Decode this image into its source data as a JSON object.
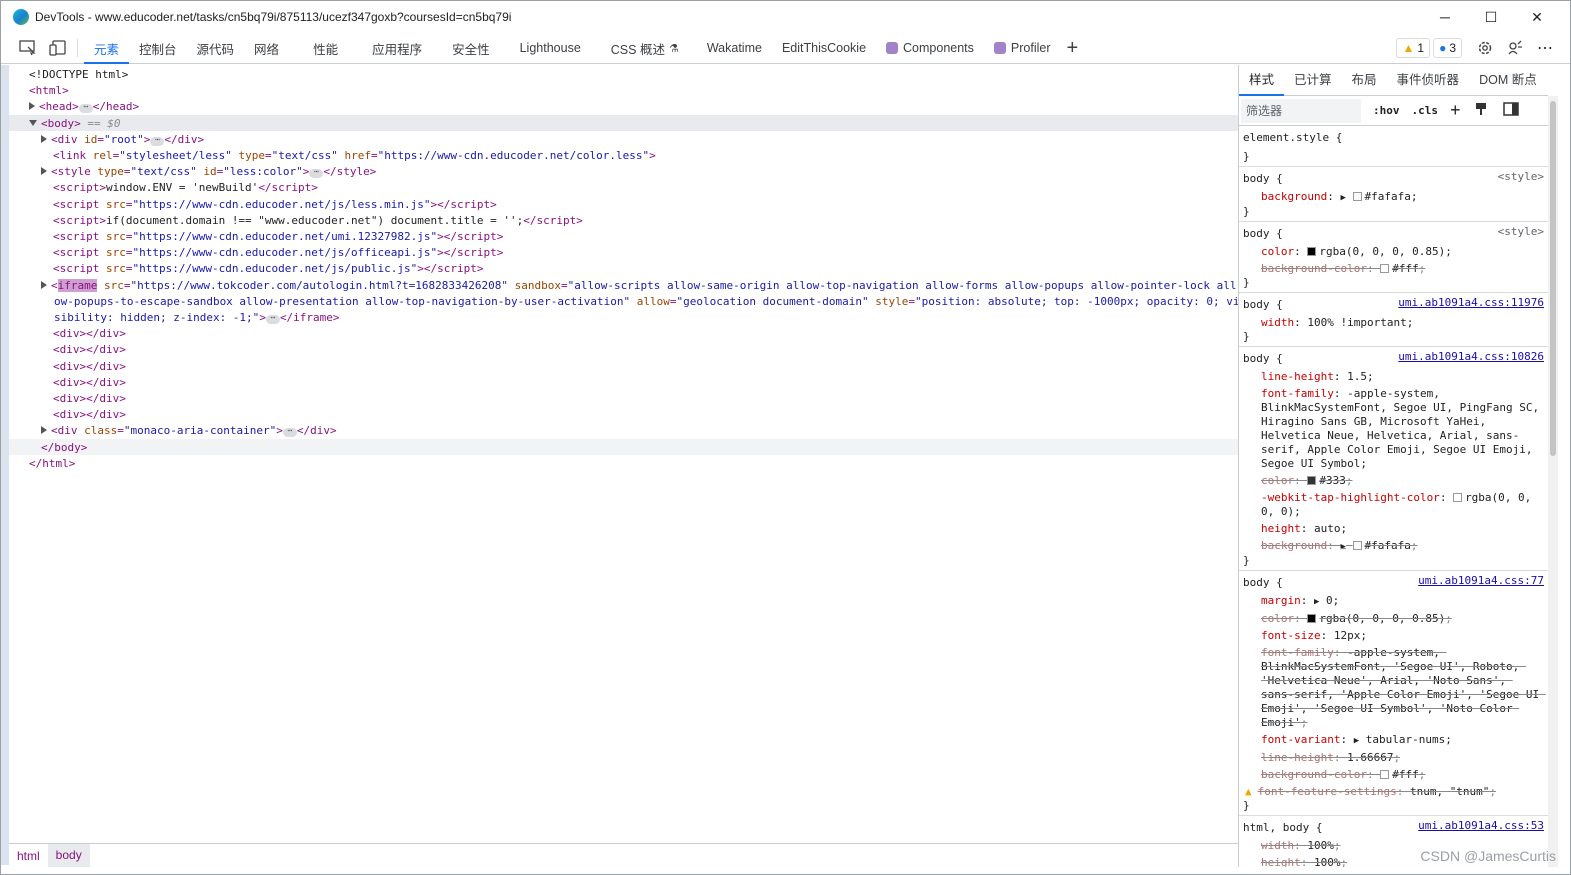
{
  "window": {
    "title": "DevTools - www.educoder.net/tasks/cn5bq79i/875113/ucezf347goxb?coursesId=cn5bq79i",
    "controls": [
      "─",
      "☐",
      "✕"
    ]
  },
  "toolbar": {
    "tabs": [
      "元素",
      "控制台",
      "源代码",
      "网络",
      "性能",
      "应用程序",
      "安全性",
      "Lighthouse",
      "CSS 概述",
      "Wakatime",
      "EditThisCookie",
      "Components",
      "Profiler"
    ],
    "active_tab": "元素",
    "warnings_count": "1",
    "messages_count": "3",
    "add_tab": "+"
  },
  "elements": {
    "dom_lines": [
      {
        "kind": "text",
        "text": "<!DOCTYPE html>",
        "indent": 0
      },
      {
        "kind": "open",
        "tag": "html",
        "indent": 0
      },
      {
        "kind": "collapsed",
        "tag": "head",
        "indent": 1
      },
      {
        "kind": "body",
        "tag": "body",
        "marker": "== $0",
        "indent": 1
      },
      {
        "kind": "collapsed_attr",
        "tag": "div",
        "attrs": [
          [
            "id",
            "root"
          ]
        ],
        "indent": 2
      },
      {
        "kind": "void",
        "tag": "link",
        "attrs": [
          [
            "rel",
            "stylesheet/less"
          ],
          [
            "type",
            "text/css"
          ],
          [
            "href",
            "https://www-cdn.educoder.net/color.less"
          ]
        ],
        "indent": 2
      },
      {
        "kind": "collapsed_attr",
        "tag": "style",
        "attrs": [
          [
            "type",
            "text/css"
          ],
          [
            "id",
            "less:color"
          ]
        ],
        "indent": 2
      },
      {
        "kind": "script_text",
        "tag": "script",
        "text": "window.ENV = 'newBuild'",
        "indent": 2
      },
      {
        "kind": "script_src",
        "tag": "script",
        "attrs": [
          [
            "src",
            "https://www-cdn.educoder.net/js/less.min.js"
          ]
        ],
        "indent": 2
      },
      {
        "kind": "script_text",
        "tag": "script",
        "text": "if(document.domain !== \"www.educoder.net\") document.title = '';",
        "indent": 2
      },
      {
        "kind": "script_src",
        "tag": "script",
        "attrs": [
          [
            "src",
            "https://www-cdn.educoder.net/umi.12327982.js"
          ]
        ],
        "indent": 2
      },
      {
        "kind": "script_src",
        "tag": "script",
        "attrs": [
          [
            "src",
            "https://www-cdn.educoder.net/js/officeapi.js"
          ]
        ],
        "indent": 2
      },
      {
        "kind": "script_src",
        "tag": "script",
        "attrs": [
          [
            "src",
            "https://www-cdn.educoder.net/js/public.js"
          ]
        ],
        "indent": 2
      }
    ],
    "iframe": {
      "line1_src": "https://www.tokcoder.com/autologin.html?t=1682833426208",
      "line1_sandbox_start": "allow-scripts allow-same-origin allow-top-navigation allow-forms allow-popups allow-pointer-lock all",
      "line2_sandbox_end": "ow-popups-to-escape-sandbox allow-presentation allow-top-navigation-by-user-activation",
      "allow": "geolocation document-domain",
      "style_start": "position: absolute; top: -1000px; opacity: 0; vi",
      "line3": "sibility: hidden; z-index: -1;"
    },
    "empty_divs": 6,
    "monaco": "monaco-aria-container"
  },
  "breadcrumbs": [
    "html",
    "body"
  ],
  "styles_pane": {
    "tabs": [
      "样式",
      "已计算",
      "布局",
      "事件侦听器",
      "DOM 断点"
    ],
    "filter_placeholder": "筛选器",
    "hov": ":hov",
    "cls": ".cls",
    "rules": [
      {
        "selector": "element.style {",
        "source": "",
        "props": []
      },
      {
        "selector": "body {",
        "source": "<style>",
        "props": [
          {
            "n": "background",
            "v": "#fafafa",
            "sw": "#fafafa",
            "arrow": true
          }
        ]
      },
      {
        "selector": "body {",
        "source": "<style>",
        "props": [
          {
            "n": "color",
            "v": "rgba(0, 0, 0, 0.85)",
            "sw": "#000"
          },
          {
            "n": "background-color",
            "v": "#fff",
            "sw": "#fff",
            "strike": true
          }
        ]
      },
      {
        "selector": "body {",
        "source": "umi.ab1091a4.css:11976",
        "props": [
          {
            "n": "width",
            "v": "100% !important"
          }
        ]
      },
      {
        "selector": "body {",
        "source": "umi.ab1091a4.css:10826",
        "props": [
          {
            "n": "line-height",
            "v": "1.5"
          },
          {
            "n": "font-family",
            "v": "-apple-system, BlinkMacSystemFont, Segoe UI, PingFang SC, Hiragino Sans GB, Microsoft YaHei, Helvetica Neue, Helvetica, Arial, sans-serif, Apple Color Emoji, Segoe UI Emoji, Segoe UI Symbol"
          },
          {
            "n": "color",
            "v": "#333",
            "sw": "#333",
            "strike": true
          },
          {
            "n": "-webkit-tap-highlight-color",
            "v": "rgba(0, 0, 0, 0)",
            "sw": "transparent"
          },
          {
            "n": "height",
            "v": "auto"
          },
          {
            "n": "background",
            "v": "#fafafa",
            "sw": "#fafafa",
            "arrow": true,
            "strike": true
          }
        ]
      },
      {
        "selector": "body {",
        "source": "umi.ab1091a4.css:77",
        "props": [
          {
            "n": "margin",
            "v": "0",
            "arrow": true
          },
          {
            "n": "color",
            "v": "rgba(0, 0, 0, 0.85)",
            "sw": "#000",
            "strike": true
          },
          {
            "n": "font-size",
            "v": "12px"
          },
          {
            "n": "font-family",
            "v": "-apple-system, BlinkMacSystemFont, 'Segoe UI', Roboto, 'Helvetica Neue', Arial, 'Noto Sans', sans-serif, 'Apple Color Emoji', 'Segoe UI Emoji', 'Segoe UI Symbol', 'Noto Color Emoji'",
            "strike": true
          },
          {
            "n": "font-variant",
            "v": "tabular-nums",
            "arrow": true
          },
          {
            "n": "line-height",
            "v": "1.66667",
            "strike": true
          },
          {
            "n": "background-color",
            "v": "#fff",
            "sw": "#fff",
            "strike": true
          },
          {
            "n": "font-feature-settings",
            "v": "tnum, \"tnum\"",
            "strike": true,
            "warn": true
          }
        ]
      },
      {
        "selector": "html, body {",
        "source": "umi.ab1091a4.css:53",
        "props": [
          {
            "n": "width",
            "v": "100%",
            "strike": true
          },
          {
            "n": "height",
            "v": "100%",
            "strike": true
          }
        ]
      }
    ]
  },
  "watermark": "CSDN @JamesCurtis",
  "colors": {
    "accent": "#1a73e8",
    "tag": "#881280",
    "attr_name": "#994500",
    "attr_value": "#1a1aa6",
    "prop_name": "#c80000"
  }
}
